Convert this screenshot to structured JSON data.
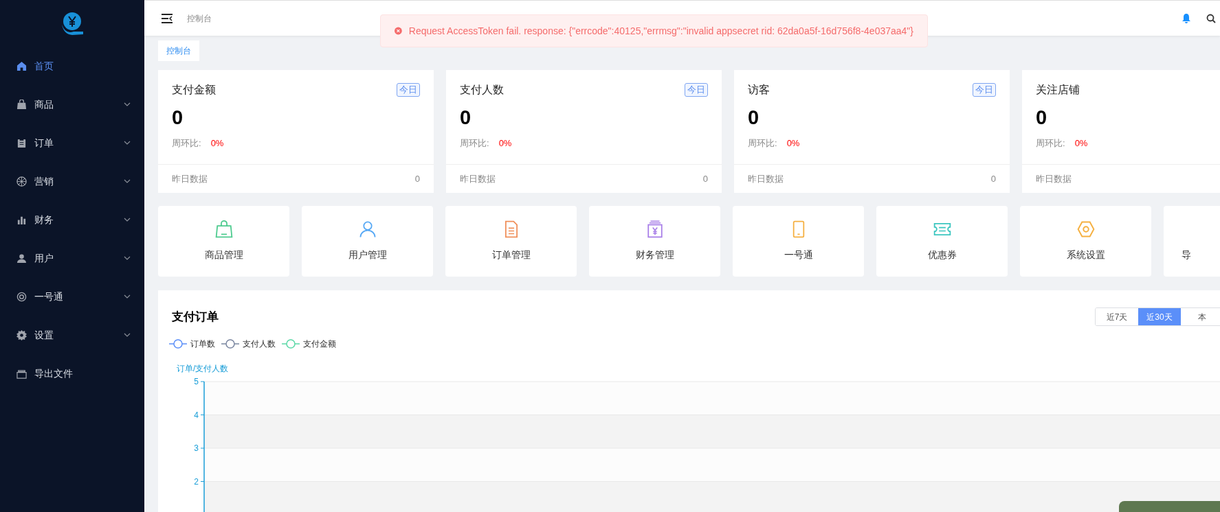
{
  "sidebar": {
    "items": [
      {
        "kind": "home",
        "label": "首页",
        "selected": true,
        "expandable": false
      },
      {
        "kind": "bag",
        "label": "商品",
        "selected": false,
        "expandable": true
      },
      {
        "kind": "clipboard",
        "label": "订单",
        "selected": false,
        "expandable": true
      },
      {
        "kind": "wheel",
        "label": "营销",
        "selected": false,
        "expandable": true
      },
      {
        "kind": "bars",
        "label": "财务",
        "selected": false,
        "expandable": true
      },
      {
        "kind": "user",
        "label": "用户",
        "selected": false,
        "expandable": true
      },
      {
        "kind": "ring",
        "label": "一号通",
        "selected": false,
        "expandable": true
      },
      {
        "kind": "gear",
        "label": "设置",
        "selected": false,
        "expandable": true
      },
      {
        "kind": "tray",
        "label": "导出文件",
        "selected": false,
        "expandable": false
      }
    ]
  },
  "header": {
    "breadcrumb": "控制台"
  },
  "toast": {
    "message": "Request AccessToken fail. response: {\"errcode\":40125,\"errmsg\":\"invalid appsecret rid: 62da0a5f-16d756f8-4e037aa4\"}"
  },
  "tag": "控制台",
  "stats": [
    {
      "title": "支付金额",
      "badge": "今日",
      "value": "0",
      "compare_label": "周环比:",
      "compare_value": "0%",
      "yesterday_label": "昨日数据",
      "yesterday_value": "0"
    },
    {
      "title": "支付人数",
      "badge": "今日",
      "value": "0",
      "compare_label": "周环比:",
      "compare_value": "0%",
      "yesterday_label": "昨日数据",
      "yesterday_value": "0"
    },
    {
      "title": "访客",
      "badge": "今日",
      "value": "0",
      "compare_label": "周环比:",
      "compare_value": "0%",
      "yesterday_label": "昨日数据",
      "yesterday_value": "0"
    },
    {
      "title": "关注店铺",
      "value": "0",
      "compare_label": "周环比:",
      "compare_value": "0%",
      "yesterday_label": "昨日数据"
    }
  ],
  "quick_links": [
    {
      "kind": "bag",
      "label": "商品管理",
      "color": "#4ecb8f"
    },
    {
      "kind": "user",
      "label": "用户管理",
      "color": "#56a8f5"
    },
    {
      "kind": "doc",
      "label": "订单管理",
      "color": "#f08f5a"
    },
    {
      "kind": "money",
      "label": "财务管理",
      "color": "#a87ee8"
    },
    {
      "kind": "phone",
      "label": "一号通",
      "color": "#f5b041"
    },
    {
      "kind": "ticket",
      "label": "优惠券",
      "color": "#3cc6c0"
    },
    {
      "kind": "hex",
      "label": "系统设置",
      "color": "#f5b041"
    },
    {
      "kind": "clipped",
      "label": "导"
    }
  ],
  "orders_panel": {
    "title": "支付订单",
    "ranges": [
      {
        "label": "近7天",
        "selected": false
      },
      {
        "label": "近30天",
        "selected": true
      },
      {
        "label": "本",
        "selected": false
      }
    ],
    "chart_data": {
      "type": "line",
      "ylabel": "订单/支付人数",
      "ylim": [
        0,
        5
      ],
      "yticks": [
        2,
        3,
        4,
        5
      ],
      "grid": true,
      "bands": [
        {
          "axis": "y",
          "from": 1,
          "to": 2,
          "color": "#f3f3f3"
        },
        {
          "axis": "y",
          "from": 3,
          "to": 4,
          "color": "#f3f3f3"
        }
      ],
      "series": [
        {
          "name": "订单数",
          "color": "#5b8ff9"
        },
        {
          "name": "支付人数",
          "color": "#7a86a0"
        },
        {
          "name": "支付金额",
          "color": "#5ad8a6"
        }
      ]
    }
  }
}
